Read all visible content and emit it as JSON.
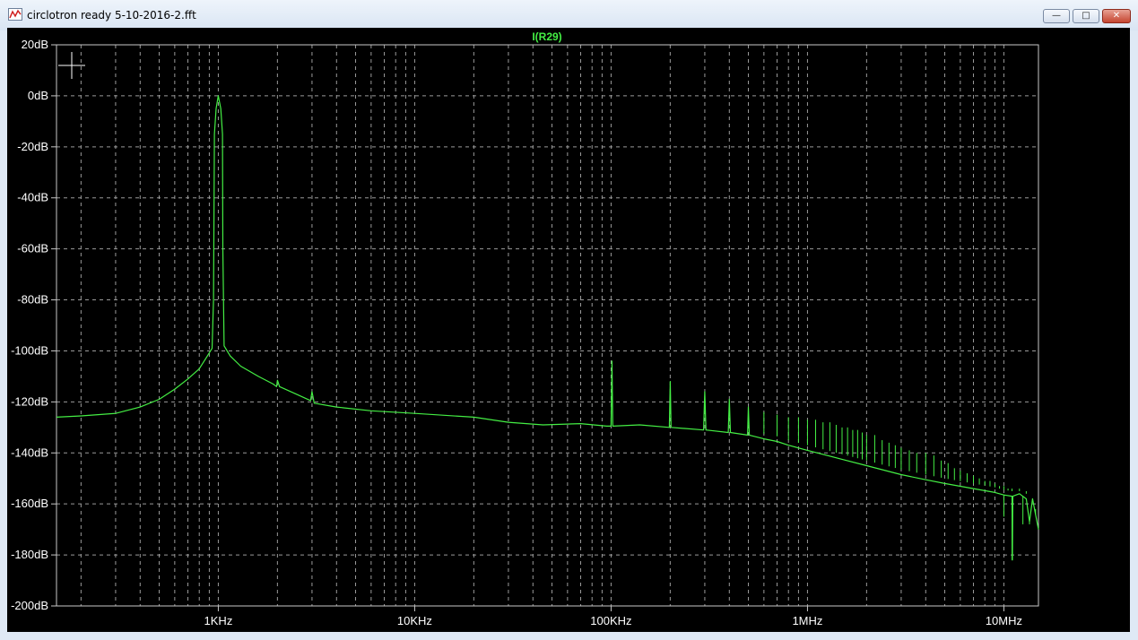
{
  "window": {
    "title": "circlotron ready 5-10-2016-2.fft",
    "controls": {
      "minimize": "—",
      "maximize": "□",
      "close": "✕"
    }
  },
  "colors": {
    "trace": "#44ee44",
    "axis_text": "#ffffff",
    "grid": "#9a9a9a",
    "background": "#000000",
    "frame": "#c8c8c8"
  },
  "chart_data": {
    "type": "line",
    "title": "I(R29)",
    "x_scale": "log",
    "x_unit": "Hz",
    "xlim": [
      150,
      15000000
    ],
    "ylim": [
      -200,
      20
    ],
    "y_ticks": [
      20,
      0,
      -20,
      -40,
      -60,
      -80,
      -100,
      -120,
      -140,
      -160,
      -180,
      -200
    ],
    "y_tick_labels": [
      "20dB",
      "0dB",
      "-20dB",
      "-40dB",
      "-60dB",
      "-80dB",
      "-100dB",
      "-120dB",
      "-140dB",
      "-160dB",
      "-180dB",
      "-200dB"
    ],
    "x_ticks": [
      1000,
      10000,
      100000,
      1000000,
      10000000
    ],
    "x_tick_labels": [
      "1KHz",
      "10KHz",
      "100KHz",
      "1MHz",
      "10MHz"
    ],
    "grid": true,
    "series": [
      {
        "name": "I(R29)",
        "points": [
          [
            150,
            -126
          ],
          [
            200,
            -125.5
          ],
          [
            300,
            -124.5
          ],
          [
            400,
            -122
          ],
          [
            500,
            -119
          ],
          [
            600,
            -115
          ],
          [
            700,
            -111
          ],
          [
            800,
            -107
          ],
          [
            880,
            -102
          ],
          [
            930,
            -99
          ],
          [
            945,
            -80
          ],
          [
            955,
            -15
          ],
          [
            975,
            -5
          ],
          [
            1000,
            0
          ],
          [
            1030,
            -5
          ],
          [
            1050,
            -15
          ],
          [
            1055,
            -60
          ],
          [
            1070,
            -98
          ],
          [
            1150,
            -102
          ],
          [
            1300,
            -106
          ],
          [
            1600,
            -110
          ],
          [
            1900,
            -113
          ],
          [
            1980,
            -114
          ],
          [
            2000,
            -111.5
          ],
          [
            2050,
            -114
          ],
          [
            2500,
            -117
          ],
          [
            2950,
            -119.5
          ],
          [
            3000,
            -116
          ],
          [
            3080,
            -120.5
          ],
          [
            4000,
            -122
          ],
          [
            6000,
            -123.5
          ],
          [
            10000,
            -124.5
          ],
          [
            20000,
            -126
          ],
          [
            30000,
            -128
          ],
          [
            45000,
            -129
          ],
          [
            70000,
            -128.5
          ],
          [
            95000,
            -129.5
          ],
          [
            100000,
            -129.5
          ],
          [
            101000,
            -104
          ],
          [
            102000,
            -129.5
          ],
          [
            140000,
            -129
          ],
          [
            198000,
            -130
          ],
          [
            200000,
            -112
          ],
          [
            202000,
            -130
          ],
          [
            296000,
            -131
          ],
          [
            300000,
            -116
          ],
          [
            304000,
            -131
          ],
          [
            395000,
            -132
          ],
          [
            400000,
            -119
          ],
          [
            405000,
            -132
          ],
          [
            495000,
            -133
          ],
          [
            500000,
            -122
          ],
          [
            506000,
            -133
          ],
          [
            600000,
            -134.5
          ],
          [
            700000,
            -135.5
          ],
          [
            800000,
            -137
          ],
          [
            1000000,
            -139
          ],
          [
            1500000,
            -142.5
          ],
          [
            2000000,
            -145
          ],
          [
            3000000,
            -148.5
          ],
          [
            4000000,
            -150.5
          ],
          [
            5000000,
            -152
          ],
          [
            7000000,
            -154
          ],
          [
            9000000,
            -155.5
          ],
          [
            10000000,
            -156.5
          ],
          [
            11000000,
            -157
          ],
          [
            11050000,
            -182
          ],
          [
            11100000,
            -157
          ],
          [
            12000000,
            -156
          ],
          [
            13000000,
            -158
          ],
          [
            13500000,
            -167
          ],
          [
            14000000,
            -158
          ],
          [
            15000000,
            -170
          ]
        ],
        "comb_spikes": [
          [
            600000,
            -124
          ],
          [
            700000,
            -125
          ],
          [
            800000,
            -126
          ],
          [
            900000,
            -126
          ],
          [
            1000000,
            -127
          ],
          [
            1100000,
            -127
          ],
          [
            1200000,
            -128
          ],
          [
            1300000,
            -128
          ],
          [
            1400000,
            -129
          ],
          [
            1500000,
            -130
          ],
          [
            1600000,
            -130
          ],
          [
            1700000,
            -131
          ],
          [
            1800000,
            -131
          ],
          [
            1900000,
            -132
          ],
          [
            2000000,
            -133
          ],
          [
            2200000,
            -133
          ],
          [
            2400000,
            -135
          ],
          [
            2600000,
            -136
          ],
          [
            2800000,
            -137
          ],
          [
            3000000,
            -138
          ],
          [
            3300000,
            -139
          ],
          [
            3600000,
            -140
          ],
          [
            4000000,
            -140
          ],
          [
            4400000,
            -141
          ],
          [
            4800000,
            -143
          ],
          [
            5200000,
            -144
          ],
          [
            5600000,
            -146
          ],
          [
            6000000,
            -147
          ],
          [
            6500000,
            -148
          ],
          [
            7000000,
            -149
          ],
          [
            7500000,
            -150
          ],
          [
            8000000,
            -151
          ],
          [
            8500000,
            -151
          ],
          [
            9000000,
            -152
          ],
          [
            9500000,
            -153
          ],
          [
            10000000,
            -153
          ],
          [
            10500000,
            -154
          ],
          [
            11000000,
            -154
          ],
          [
            12000000,
            -155
          ],
          [
            13000000,
            -155
          ],
          [
            14000000,
            -156
          ]
        ],
        "comb_dips": [
          [
            10000000,
            -165
          ],
          [
            11000000,
            -182
          ],
          [
            12500000,
            -168
          ],
          [
            13500000,
            -168
          ],
          [
            14500000,
            -162
          ]
        ]
      }
    ]
  }
}
